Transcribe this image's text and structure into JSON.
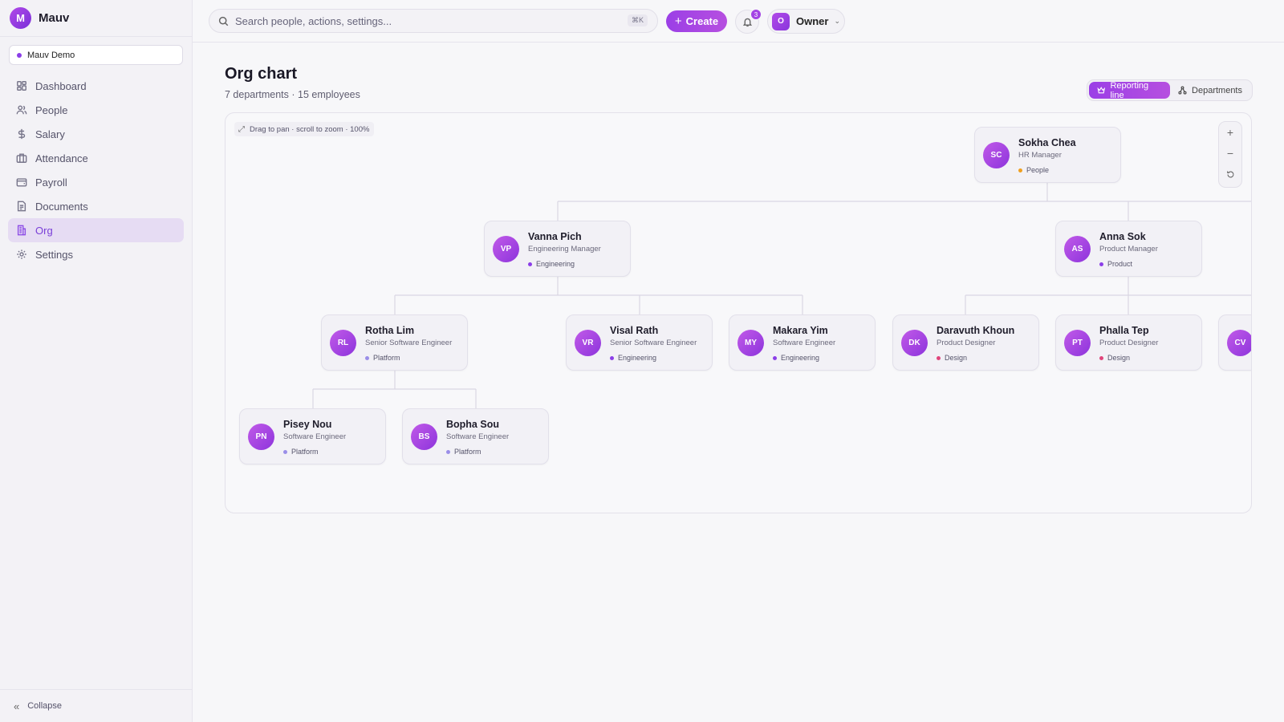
{
  "brand": {
    "logo_letter": "M",
    "name": "Mauv"
  },
  "workspace": {
    "name": "Mauv Demo"
  },
  "nav": [
    {
      "label": "Dashboard",
      "icon": "dashboard-icon",
      "active": false
    },
    {
      "label": "People",
      "icon": "people-icon",
      "active": false
    },
    {
      "label": "Salary",
      "icon": "dollar-icon",
      "active": false
    },
    {
      "label": "Attendance",
      "icon": "briefcase-icon",
      "active": false
    },
    {
      "label": "Payroll",
      "icon": "wallet-icon",
      "active": false
    },
    {
      "label": "Documents",
      "icon": "document-icon",
      "active": false
    },
    {
      "label": "Org",
      "icon": "building-icon",
      "active": true
    },
    {
      "label": "Settings",
      "icon": "gear-icon",
      "active": false
    }
  ],
  "collapse_label": "Collapse",
  "topbar": {
    "search_placeholder": "Search people, actions, settings...",
    "shortcut": "⌘K",
    "create_label": "Create",
    "notifications_count": "3",
    "user_initial": "O",
    "user_role": "Owner"
  },
  "page": {
    "title": "Org chart",
    "subtitle": "7 departments · 15 employees"
  },
  "view_toggle": {
    "reporting_line": "Reporting line",
    "departments": "Departments",
    "active": "reporting_line"
  },
  "canvas": {
    "hint": "Drag to pan · scroll to zoom · 100%",
    "zoom_percent": 100
  },
  "department_colors": {
    "People": "#f0a020",
    "Engineering": "#8b3ee8",
    "Product": "#8b3ee8",
    "Platform": "#9a8ee8",
    "Design": "#e0457b"
  },
  "employees": [
    {
      "initials": "SC",
      "name": "Sokha Chea",
      "role": "HR Manager",
      "dept": "People"
    },
    {
      "initials": "VP",
      "name": "Vanna Pich",
      "role": "Engineering Manager",
      "dept": "Engineering"
    },
    {
      "initials": "AS",
      "name": "Anna Sok",
      "role": "Product Manager",
      "dept": "Product"
    },
    {
      "initials": "RL",
      "name": "Rotha Lim",
      "role": "Senior Software Engineer",
      "dept": "Platform"
    },
    {
      "initials": "VR",
      "name": "Visal Rath",
      "role": "Senior Software Engineer",
      "dept": "Engineering"
    },
    {
      "initials": "MY",
      "name": "Makara Yim",
      "role": "Software Engineer",
      "dept": "Engineering"
    },
    {
      "initials": "DK",
      "name": "Daravuth Khoun",
      "role": "Product Designer",
      "dept": "Design"
    },
    {
      "initials": "PT",
      "name": "Phalla Tep",
      "role": "Product Designer",
      "dept": "Design"
    },
    {
      "initials": "CV",
      "name": "",
      "role": "",
      "dept": ""
    },
    {
      "initials": "PN",
      "name": "Pisey Nou",
      "role": "Software Engineer",
      "dept": "Platform"
    },
    {
      "initials": "BS",
      "name": "Bopha Sou",
      "role": "Software Engineer",
      "dept": "Platform"
    }
  ]
}
